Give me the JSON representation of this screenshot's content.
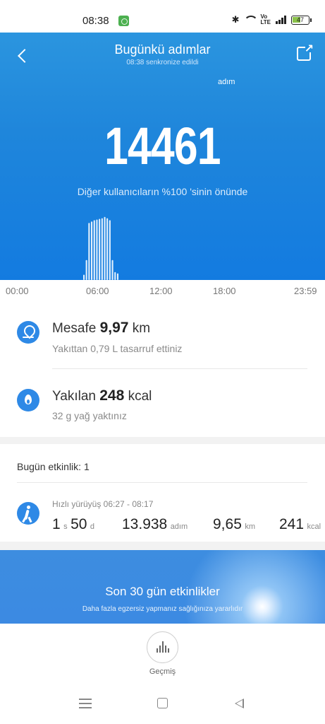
{
  "status_bar": {
    "time": "08:38",
    "volte_line1": "Vo",
    "volte_line2": "LTE",
    "battery": "47"
  },
  "header": {
    "title": "Bugünkü adımlar",
    "subtitle": "08:38 senkronize edildi"
  },
  "steps": {
    "count": "14461",
    "unit": "adım",
    "rank_text": "Diğer kullanıcıların %100 'sinin önünde"
  },
  "chart_data": {
    "type": "bar",
    "x_axis_labels": [
      "00:00",
      "06:00",
      "12:00",
      "18:00",
      "23:59"
    ],
    "x_unit": "hour of day",
    "xlim": [
      0,
      24
    ],
    "bars": [
      {
        "hour": 5.8,
        "value": 8
      },
      {
        "hour": 6.0,
        "value": 30
      },
      {
        "hour": 6.2,
        "value": 86
      },
      {
        "hour": 6.4,
        "value": 88
      },
      {
        "hour": 6.6,
        "value": 90
      },
      {
        "hour": 6.8,
        "value": 91
      },
      {
        "hour": 7.0,
        "value": 92
      },
      {
        "hour": 7.2,
        "value": 93
      },
      {
        "hour": 7.4,
        "value": 95
      },
      {
        "hour": 7.6,
        "value": 93
      },
      {
        "hour": 7.8,
        "value": 90
      },
      {
        "hour": 8.0,
        "value": 30
      },
      {
        "hour": 8.2,
        "value": 12
      },
      {
        "hour": 8.4,
        "value": 10
      }
    ],
    "color": "#e3f0fc"
  },
  "metrics": {
    "distance_label": "Mesafe",
    "distance_value": "9,97",
    "distance_unit": "km",
    "distance_sub": "Yakıttan 0,79 L tasarruf ettiniz",
    "calories_label": "Yakılan",
    "calories_value": "248",
    "calories_unit": "kcal",
    "calories_sub": "32 g yağ yaktınız"
  },
  "activity": {
    "title": "Bugün etkinlik:",
    "count": "1",
    "name_time": "Hızlı yürüyüş 06:27 - 08:17",
    "duration_h": "1",
    "duration_h_unit": "s",
    "duration_m": "50",
    "duration_m_unit": "d",
    "steps": "13.938",
    "steps_unit": "adım",
    "distance": "9,65",
    "distance_unit": "km",
    "kcal": "241",
    "kcal_unit": "kcal"
  },
  "banner": {
    "title": "Son 30 gün etkinlikler",
    "subtitle": "Daha fazla egzersiz yapmanız sağlığınıza yararlıdır"
  },
  "history": {
    "label": "Geçmiş"
  },
  "colors": {
    "accent": "#2e89e6",
    "hero_top": "#2b95df",
    "hero_bottom": "#137be0"
  }
}
